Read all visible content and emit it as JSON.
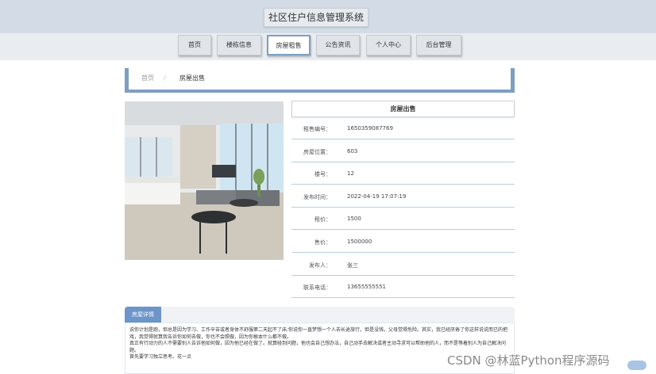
{
  "header": {
    "title": "社区住户信息管理系统"
  },
  "nav": {
    "items": [
      {
        "label": "首页"
      },
      {
        "label": "楼栋信息"
      },
      {
        "label": "房屋租售"
      },
      {
        "label": "公告资讯"
      },
      {
        "label": "个人中心"
      },
      {
        "label": "后台管理"
      }
    ],
    "active_index": 2
  },
  "breadcrumb": {
    "home": "首页",
    "separator": "/",
    "current": "房屋出售"
  },
  "detail": {
    "title": "房屋出售",
    "fields": [
      {
        "label": "租售编号：",
        "value": "1650359087769"
      },
      {
        "label": "房屋位置：",
        "value": "603"
      },
      {
        "label": "楼号：",
        "value": "12"
      },
      {
        "label": "发布时间：",
        "value": "2022-04-19 17:07:19"
      },
      {
        "label": "租价：",
        "value": "1500"
      },
      {
        "label": "售价：",
        "value": "1500000"
      },
      {
        "label": "发布人：",
        "value": "张三"
      },
      {
        "label": "联系电话：",
        "value": "13655555551"
      }
    ]
  },
  "description": {
    "tab_label": "房屋详情",
    "lines": [
      "说你计划是跑，但总是因为学习、工作辛苦或者身体不舒服第二天起不了床;你说你一直梦想一个人去长途旅行，但是没钱，父母觉得危险。其实，我已经厌倦了你这样说说而已的把戏，我觉得就算我告诉你如何去做，你也不会照做，因为你根本什么都不做。",
      "真正有行动力的人不需要别人告诉他如何做，因为他已经在做了。就算碰到问题，他也会自己想办法，自己动手去解决或者主动寻求可以帮助他的人，而不是等着别人为自己解决问题。",
      "首先要学习独立思考。花一点"
    ]
  },
  "watermark": "CSDN @林蓝Python程序源码"
}
